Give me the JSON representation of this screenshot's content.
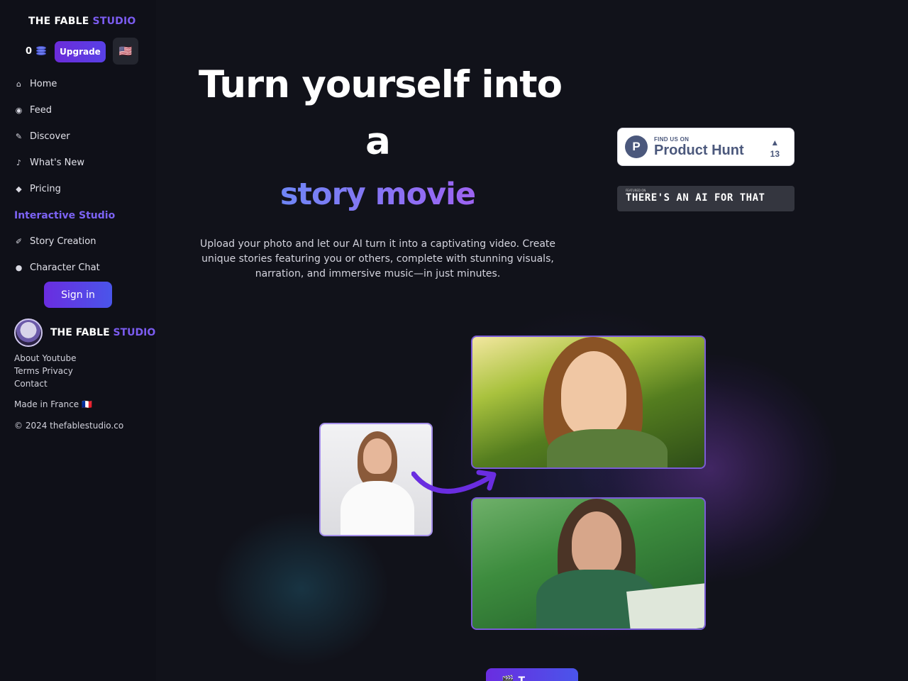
{
  "sidebar": {
    "brand": {
      "part1": "THE FABLE ",
      "part2": "STUDIO"
    },
    "credits": "0",
    "upgrade_label": "Upgrade",
    "flag": "🇺🇸",
    "nav": [
      {
        "label": "Home",
        "icon": "home-icon",
        "glyph": "⌂"
      },
      {
        "label": "Feed",
        "icon": "compass-icon",
        "glyph": "◉"
      },
      {
        "label": "Discover",
        "icon": "magic-wand-icon",
        "glyph": "✎"
      },
      {
        "label": "What's New",
        "icon": "bell-icon",
        "glyph": "♪"
      },
      {
        "label": "Pricing",
        "icon": "tag-icon",
        "glyph": "◆"
      },
      {
        "label": "Interactive Studio"
      },
      {
        "label": "Story Creation",
        "icon": "feather-icon",
        "glyph": "✐"
      },
      {
        "label": "Character Chat",
        "icon": "chat-bubbles-icon",
        "glyph": "●"
      }
    ],
    "signin_label": "Sign in",
    "footer": {
      "brand_part1": "THE FABLE ",
      "brand_part2": "STUDIO",
      "links": [
        "About",
        "Youtube",
        "Terms",
        "Privacy",
        "Contact"
      ],
      "made_in": "Made in France 🇫🇷",
      "copyright": "© 2024 thefablestudio.co"
    }
  },
  "hero": {
    "title_line1": "Turn yourself into",
    "title_line2": "a",
    "title_accent": "story movie",
    "subtitle": "Upload your photo and let our AI turn it into a captivating video. Create unique stories featuring you or others, complete with stunning visuals, narration, and immersive music—in just minutes."
  },
  "badges": {
    "product_hunt": {
      "small": "FIND US ON",
      "big": "Product Hunt",
      "logo": "P",
      "votes": "13",
      "arrow": "▲"
    },
    "aift": {
      "small": "FEATURED ON",
      "big": "THERE'S AN AI FOR THAT"
    }
  },
  "cta": {
    "icon": "clapperboard-icon",
    "label": "T"
  },
  "colors": {
    "accent": "#7b5cf0",
    "button": "#5840e6",
    "background": "#11121a"
  }
}
